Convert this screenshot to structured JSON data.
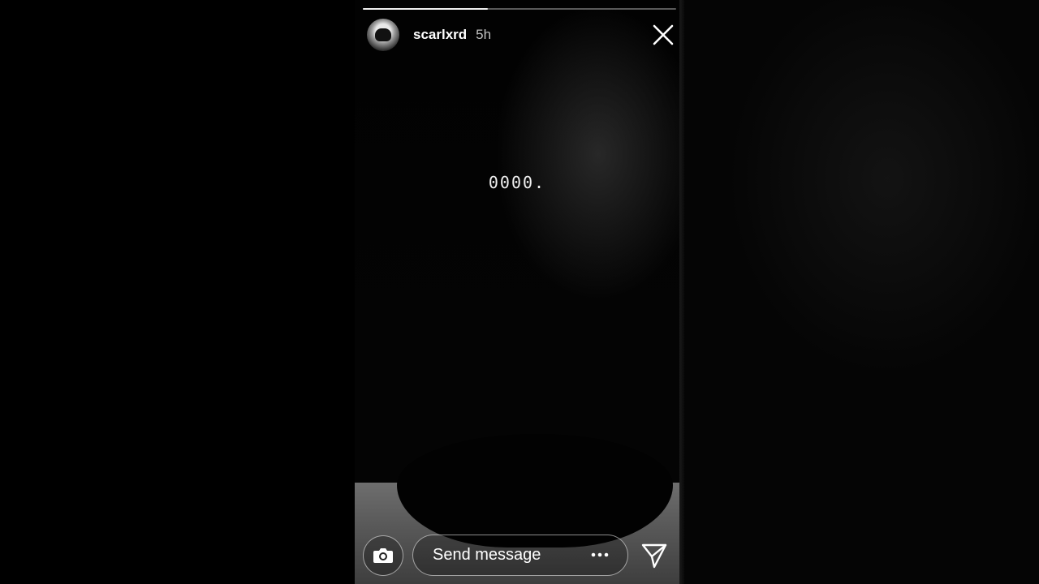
{
  "story": {
    "username": "scarlxrd",
    "time_ago": "5h",
    "caption": "0000.",
    "progress": 0.4
  },
  "reply": {
    "placeholder": "Send message"
  },
  "icons": {
    "avatar": "profile-avatar",
    "close": "close-icon",
    "camera": "camera-icon",
    "more": "more-dots-icon",
    "send": "send-icon"
  },
  "colors": {
    "background": "#000000",
    "text": "#ffffff"
  }
}
